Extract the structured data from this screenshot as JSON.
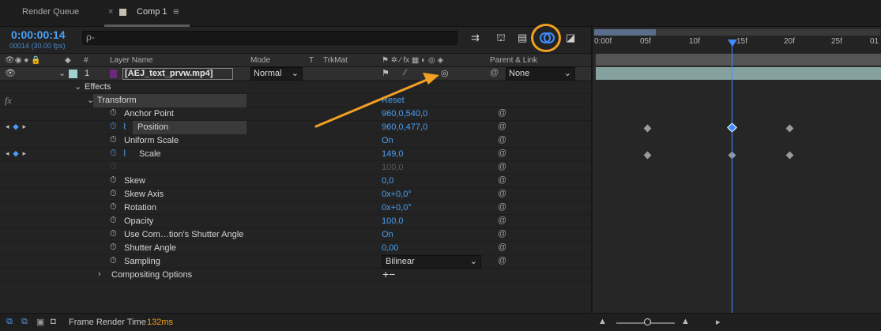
{
  "tabs": {
    "render_queue": "Render Queue",
    "comp": "Comp 1",
    "close": "×",
    "menu": "≡"
  },
  "header": {
    "timecode": "0:00:00:14",
    "fps": "00014 (30.00 fps)",
    "search_icon": "ρ-"
  },
  "columns": {
    "layer_name": "Layer Name",
    "mode": "Mode",
    "t": "T",
    "trkmat": "TrkMat",
    "parent_link": "Parent & Link",
    "hash": "#"
  },
  "layer": {
    "number": "1",
    "name": "[AEJ_text_prvw.mp4]",
    "mode": "Normal",
    "parent": "None"
  },
  "tree": {
    "effects": "Effects",
    "transform": "Transform",
    "reset": "Reset",
    "fx": "fx",
    "compositing": "Compositing Options",
    "plus_minus": "+−"
  },
  "properties": [
    {
      "name": "Anchor Point",
      "value": "960,0,540,0"
    },
    {
      "name": "Position",
      "value": "960,0,477,0"
    },
    {
      "name": "Uniform Scale",
      "value": "On"
    },
    {
      "name": "Scale",
      "value": "149,0"
    },
    {
      "name": "",
      "value": "100,0"
    },
    {
      "name": "Skew",
      "value": "0,0"
    },
    {
      "name": "Skew Axis",
      "value": "0x+0,0°"
    },
    {
      "name": "Rotation",
      "value": "0x+0,0°"
    },
    {
      "name": "Opacity",
      "value": "100,0"
    },
    {
      "name": "Use Com…tion's Shutter Angle",
      "value": "On"
    },
    {
      "name": "Shutter Angle",
      "value": "0,00"
    },
    {
      "name": "Sampling",
      "value": "Bilinear"
    }
  ],
  "timeline": {
    "ticks": [
      "0:00f",
      "05f",
      "10f",
      "15f",
      "20f",
      "25f",
      "01"
    ]
  },
  "status": {
    "label": "Frame Render Time",
    "ms": "132ms"
  },
  "colors": {
    "accent_blue": "#4a9ff5",
    "highlight_orange": "#f2a024",
    "layer_label": "#9fd2cc"
  },
  "icons": [
    "search-icon",
    "watch-icon",
    "graph-icon",
    "spiral-icon",
    "motion-blur-icon",
    "keyframe-icon"
  ]
}
